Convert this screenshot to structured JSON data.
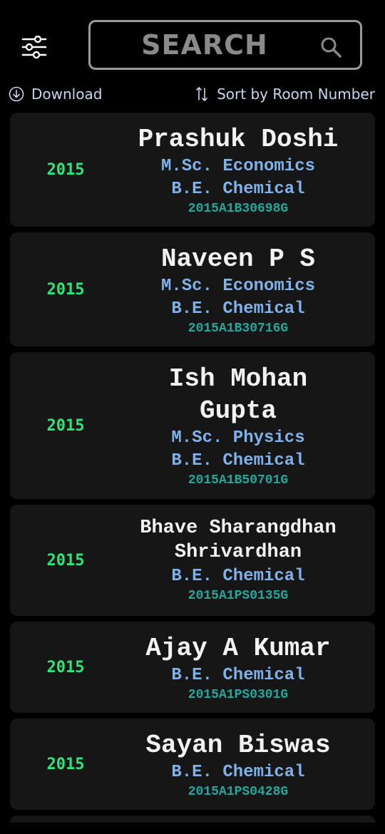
{
  "search": {
    "placeholder": "SEARCH"
  },
  "actions": {
    "download_label": "Download",
    "sort_label": "Sort by Room Number"
  },
  "colors": {
    "background": "#000000",
    "card": "#161616",
    "year": "#2ee57a",
    "degree": "#7fb1ea",
    "student_id": "#23a89c"
  },
  "icons": {
    "filter": "sliders-icon",
    "search": "search-icon",
    "download": "download-icon",
    "sort": "sort-icon"
  },
  "students": [
    {
      "year": "2015",
      "name": "Prashuk Doshi",
      "degrees": [
        "M.Sc. Economics",
        "B.E. Chemical"
      ],
      "id": "2015A1B30698G"
    },
    {
      "year": "2015",
      "name": "Naveen P S",
      "degrees": [
        "M.Sc. Economics",
        "B.E. Chemical"
      ],
      "id": "2015A1B30716G"
    },
    {
      "year": "2015",
      "name": "Ish Mohan Gupta",
      "degrees": [
        "M.Sc. Physics",
        "B.E. Chemical"
      ],
      "id": "2015A1B50701G"
    },
    {
      "year": "2015",
      "name": "Bhave Sharangdhan Shrivardhan",
      "degrees": [
        "B.E. Chemical"
      ],
      "id": "2015A1PS0135G"
    },
    {
      "year": "2015",
      "name": "Ajay A Kumar",
      "degrees": [
        "B.E. Chemical"
      ],
      "id": "2015A1PS0301G"
    },
    {
      "year": "2015",
      "name": "Sayan Biswas",
      "degrees": [
        "B.E. Chemical"
      ],
      "id": "2015A1PS0428G"
    }
  ]
}
